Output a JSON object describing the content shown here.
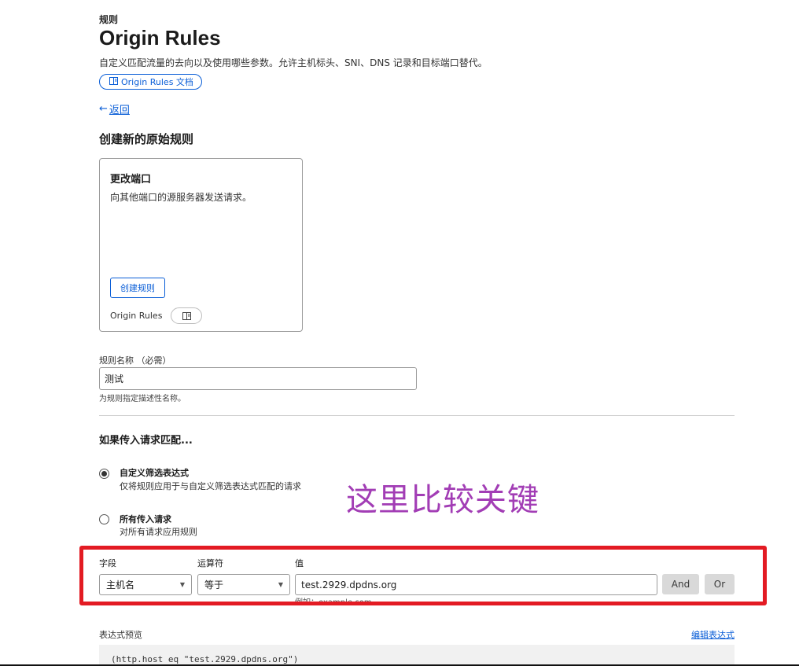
{
  "header": {
    "breadcrumb": "规则",
    "title": "Origin Rules",
    "description": "自定义匹配流量的去向以及使用哪些参数。允许主机标头、SNI、DNS 记录和目标端口替代。",
    "doc_link_label": "Origin Rules 文档",
    "doc_link_icon": "book-icon"
  },
  "nav": {
    "back_arrow": "←",
    "back_label": "返回"
  },
  "create_section": {
    "heading": "创建新的原始规则",
    "card": {
      "title": "更改端口",
      "description": "向其他端口的源服务器发送请求。",
      "button_label": "创建规则",
      "footer_label": "Origin Rules",
      "footer_icon": "book-icon"
    }
  },
  "rule_name": {
    "label": "规则名称 （必需）",
    "value": "测试",
    "helper": "为规则指定描述性名称。"
  },
  "match": {
    "heading": "如果传入请求匹配...",
    "options": [
      {
        "title": "自定义筛选表达式",
        "subtitle": "仅将规则应用于与自定义筛选表达式匹配的请求",
        "selected": true
      },
      {
        "title": "所有传入请求",
        "subtitle": "对所有请求应用规则",
        "selected": false
      }
    ]
  },
  "annotation": {
    "text": "这里比较关键",
    "color": "#a23db5",
    "box_color": "#e31b23"
  },
  "filter": {
    "field_label": "字段",
    "operator_label": "运算符",
    "value_label": "值",
    "field_value": "主机名",
    "operator_value": "等于",
    "value": "test.2929.dpdns.org",
    "example": "例如：example.com",
    "and_label": "And",
    "or_label": "Or"
  },
  "expression": {
    "label": "表达式预览",
    "edit_label": "编辑表达式",
    "code": "(http.host eq \"test.2929.dpdns.org\")"
  },
  "colors": {
    "link": "#0a5ed7",
    "text": "#1b1b1b"
  }
}
